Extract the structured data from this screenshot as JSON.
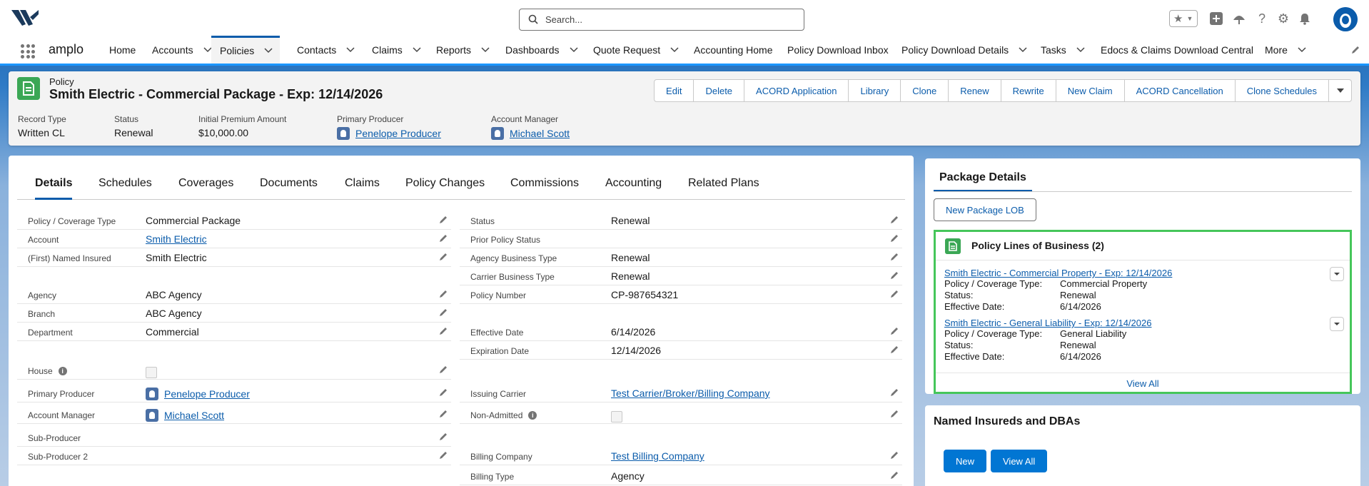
{
  "search": {
    "placeholder": "Search..."
  },
  "app": {
    "name": "amplo"
  },
  "nav": {
    "items": [
      {
        "label": "Home",
        "dropdown": false
      },
      {
        "label": "Accounts",
        "dropdown": true
      },
      {
        "label": "Policies",
        "dropdown": true,
        "active": true
      },
      {
        "label": "Contacts",
        "dropdown": true
      },
      {
        "label": "Claims",
        "dropdown": true
      },
      {
        "label": "Reports",
        "dropdown": true
      },
      {
        "label": "Dashboards",
        "dropdown": true
      },
      {
        "label": "Quote Request",
        "dropdown": true
      },
      {
        "label": "Accounting Home",
        "dropdown": false
      },
      {
        "label": "Policy Download Inbox",
        "dropdown": false
      },
      {
        "label": "Policy Download Details",
        "dropdown": true
      },
      {
        "label": "Tasks",
        "dropdown": true
      },
      {
        "label": "Edocs & Claims Download Central",
        "dropdown": false
      },
      {
        "label": "More",
        "dropdown": true
      }
    ]
  },
  "header": {
    "object": "Policy",
    "title": "Smith Electric - Commercial Package - Exp: 12/14/2026",
    "actions": [
      "Edit",
      "Delete",
      "ACORD Application",
      "Library",
      "Clone",
      "Renew",
      "Rewrite",
      "New Claim",
      "ACORD Cancellation",
      "Clone Schedules"
    ],
    "fields": [
      {
        "label": "Record Type",
        "value": "Written CL"
      },
      {
        "label": "Status",
        "value": "Renewal"
      },
      {
        "label": "Initial Premium Amount",
        "value": "$10,000.00"
      },
      {
        "label": "Primary Producer",
        "value": "Penelope Producer"
      },
      {
        "label": "Account Manager",
        "value": "Michael Scott"
      }
    ]
  },
  "tabs": [
    "Details",
    "Schedules",
    "Coverages",
    "Documents",
    "Claims",
    "Policy Changes",
    "Commissions",
    "Accounting",
    "Related Plans"
  ],
  "details": {
    "left": [
      {
        "label": "Policy / Coverage Type",
        "value": "Commercial Package"
      },
      {
        "label": "Account",
        "value": "Smith Electric"
      },
      {
        "label": "(First) Named Insured",
        "value": "Smith Electric"
      },
      {
        "label": "Agency",
        "value": "ABC Agency"
      },
      {
        "label": "Branch",
        "value": "ABC Agency"
      },
      {
        "label": "Department",
        "value": "Commercial"
      },
      {
        "label": "House",
        "value": ""
      },
      {
        "label": "Primary Producer",
        "value": "Penelope Producer"
      },
      {
        "label": "Account Manager",
        "value": "Michael Scott"
      },
      {
        "label": "Sub-Producer",
        "value": ""
      },
      {
        "label": "Sub-Producer 2",
        "value": ""
      }
    ],
    "right": [
      {
        "label": "Status",
        "value": "Renewal"
      },
      {
        "label": "Prior Policy Status",
        "value": ""
      },
      {
        "label": "Agency Business Type",
        "value": "Renewal"
      },
      {
        "label": "Carrier Business Type",
        "value": "Renewal"
      },
      {
        "label": "Policy Number",
        "value": "CP-987654321"
      },
      {
        "label": "Effective Date",
        "value": "6/14/2026"
      },
      {
        "label": "Expiration Date",
        "value": "12/14/2026"
      },
      {
        "label": "Issuing Carrier",
        "value": "Test Carrier/Broker/Billing Company"
      },
      {
        "label": "Non-Admitted",
        "value": ""
      },
      {
        "label": "Billing Company",
        "value": "Test Billing Company"
      },
      {
        "label": "Billing Type",
        "value": "Agency"
      }
    ]
  },
  "package": {
    "tab": "Package Details",
    "new_button": "New Package LOB",
    "lines_title": "Policy Lines of Business (2)",
    "records": [
      {
        "title": "Smith Electric - Commercial Property - Exp: 12/14/2026",
        "k1": "Policy / Coverage Type:",
        "v1": "Commercial Property",
        "k2": "Status:",
        "v2": "Renewal",
        "k3": "Effective Date:",
        "v3": "6/14/2026"
      },
      {
        "title": "Smith Electric - General Liability - Exp: 12/14/2026",
        "k1": "Policy / Coverage Type:",
        "v1": "General Liability",
        "k2": "Status:",
        "v2": "Renewal",
        "k3": "Effective Date:",
        "v3": "6/14/2026"
      }
    ],
    "view_all": "View All"
  },
  "insureds": {
    "title": "Named Insureds and DBAs",
    "new": "New",
    "view_all": "View All"
  },
  "colors": {
    "brand": "#0b5cab",
    "highlight": "#45c65a",
    "policy_icon": "#3ba755"
  }
}
